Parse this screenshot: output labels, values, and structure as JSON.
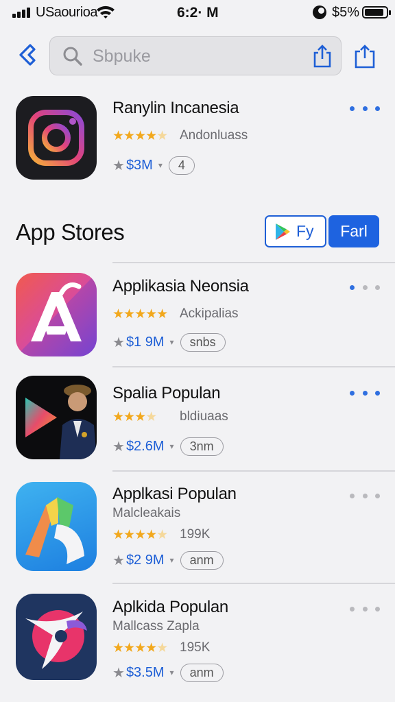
{
  "status_bar": {
    "carrier": "USaourioa",
    "time": "6:2· M",
    "battery": "$5%"
  },
  "search": {
    "placeholder": "Sbpuke"
  },
  "featured_app": {
    "name": "Ranylin Incanesia",
    "rating_text": "Andonluass",
    "stars": 4.5,
    "price": "$3M",
    "pill": "4",
    "icon": "instagram-camera-icon"
  },
  "section": {
    "title": "App Stores",
    "segment_left": "Fy",
    "segment_right": "Farl"
  },
  "apps": [
    {
      "name": "Applikasia Neonsia",
      "subtitle": "",
      "stars": 5,
      "rating_text": "Ackipalias",
      "price": "$1 9M",
      "pill": "snbs",
      "icon": "letter-a-icon"
    },
    {
      "name": "Spalia Populan",
      "subtitle": "",
      "stars": 3.5,
      "rating_text": "bldiuaas",
      "price": "$2.6M",
      "pill": "3nm",
      "icon": "play-person-icon"
    },
    {
      "name": "Applkasi Populan",
      "subtitle": "Malcleakais",
      "stars": 4.5,
      "rating_text": "199K",
      "price": "$2 9M",
      "pill": "anm",
      "icon": "abstract-shapes-icon"
    },
    {
      "name": "Aplkida Populan",
      "subtitle": "Mallcass Zapla",
      "stars": 4.5,
      "rating_text": "195K",
      "price": "$3.5M",
      "pill": "anm",
      "icon": "bird-swoosh-icon"
    }
  ],
  "colors": {
    "accent": "#1e5fd6",
    "star": "#f2a81d"
  }
}
